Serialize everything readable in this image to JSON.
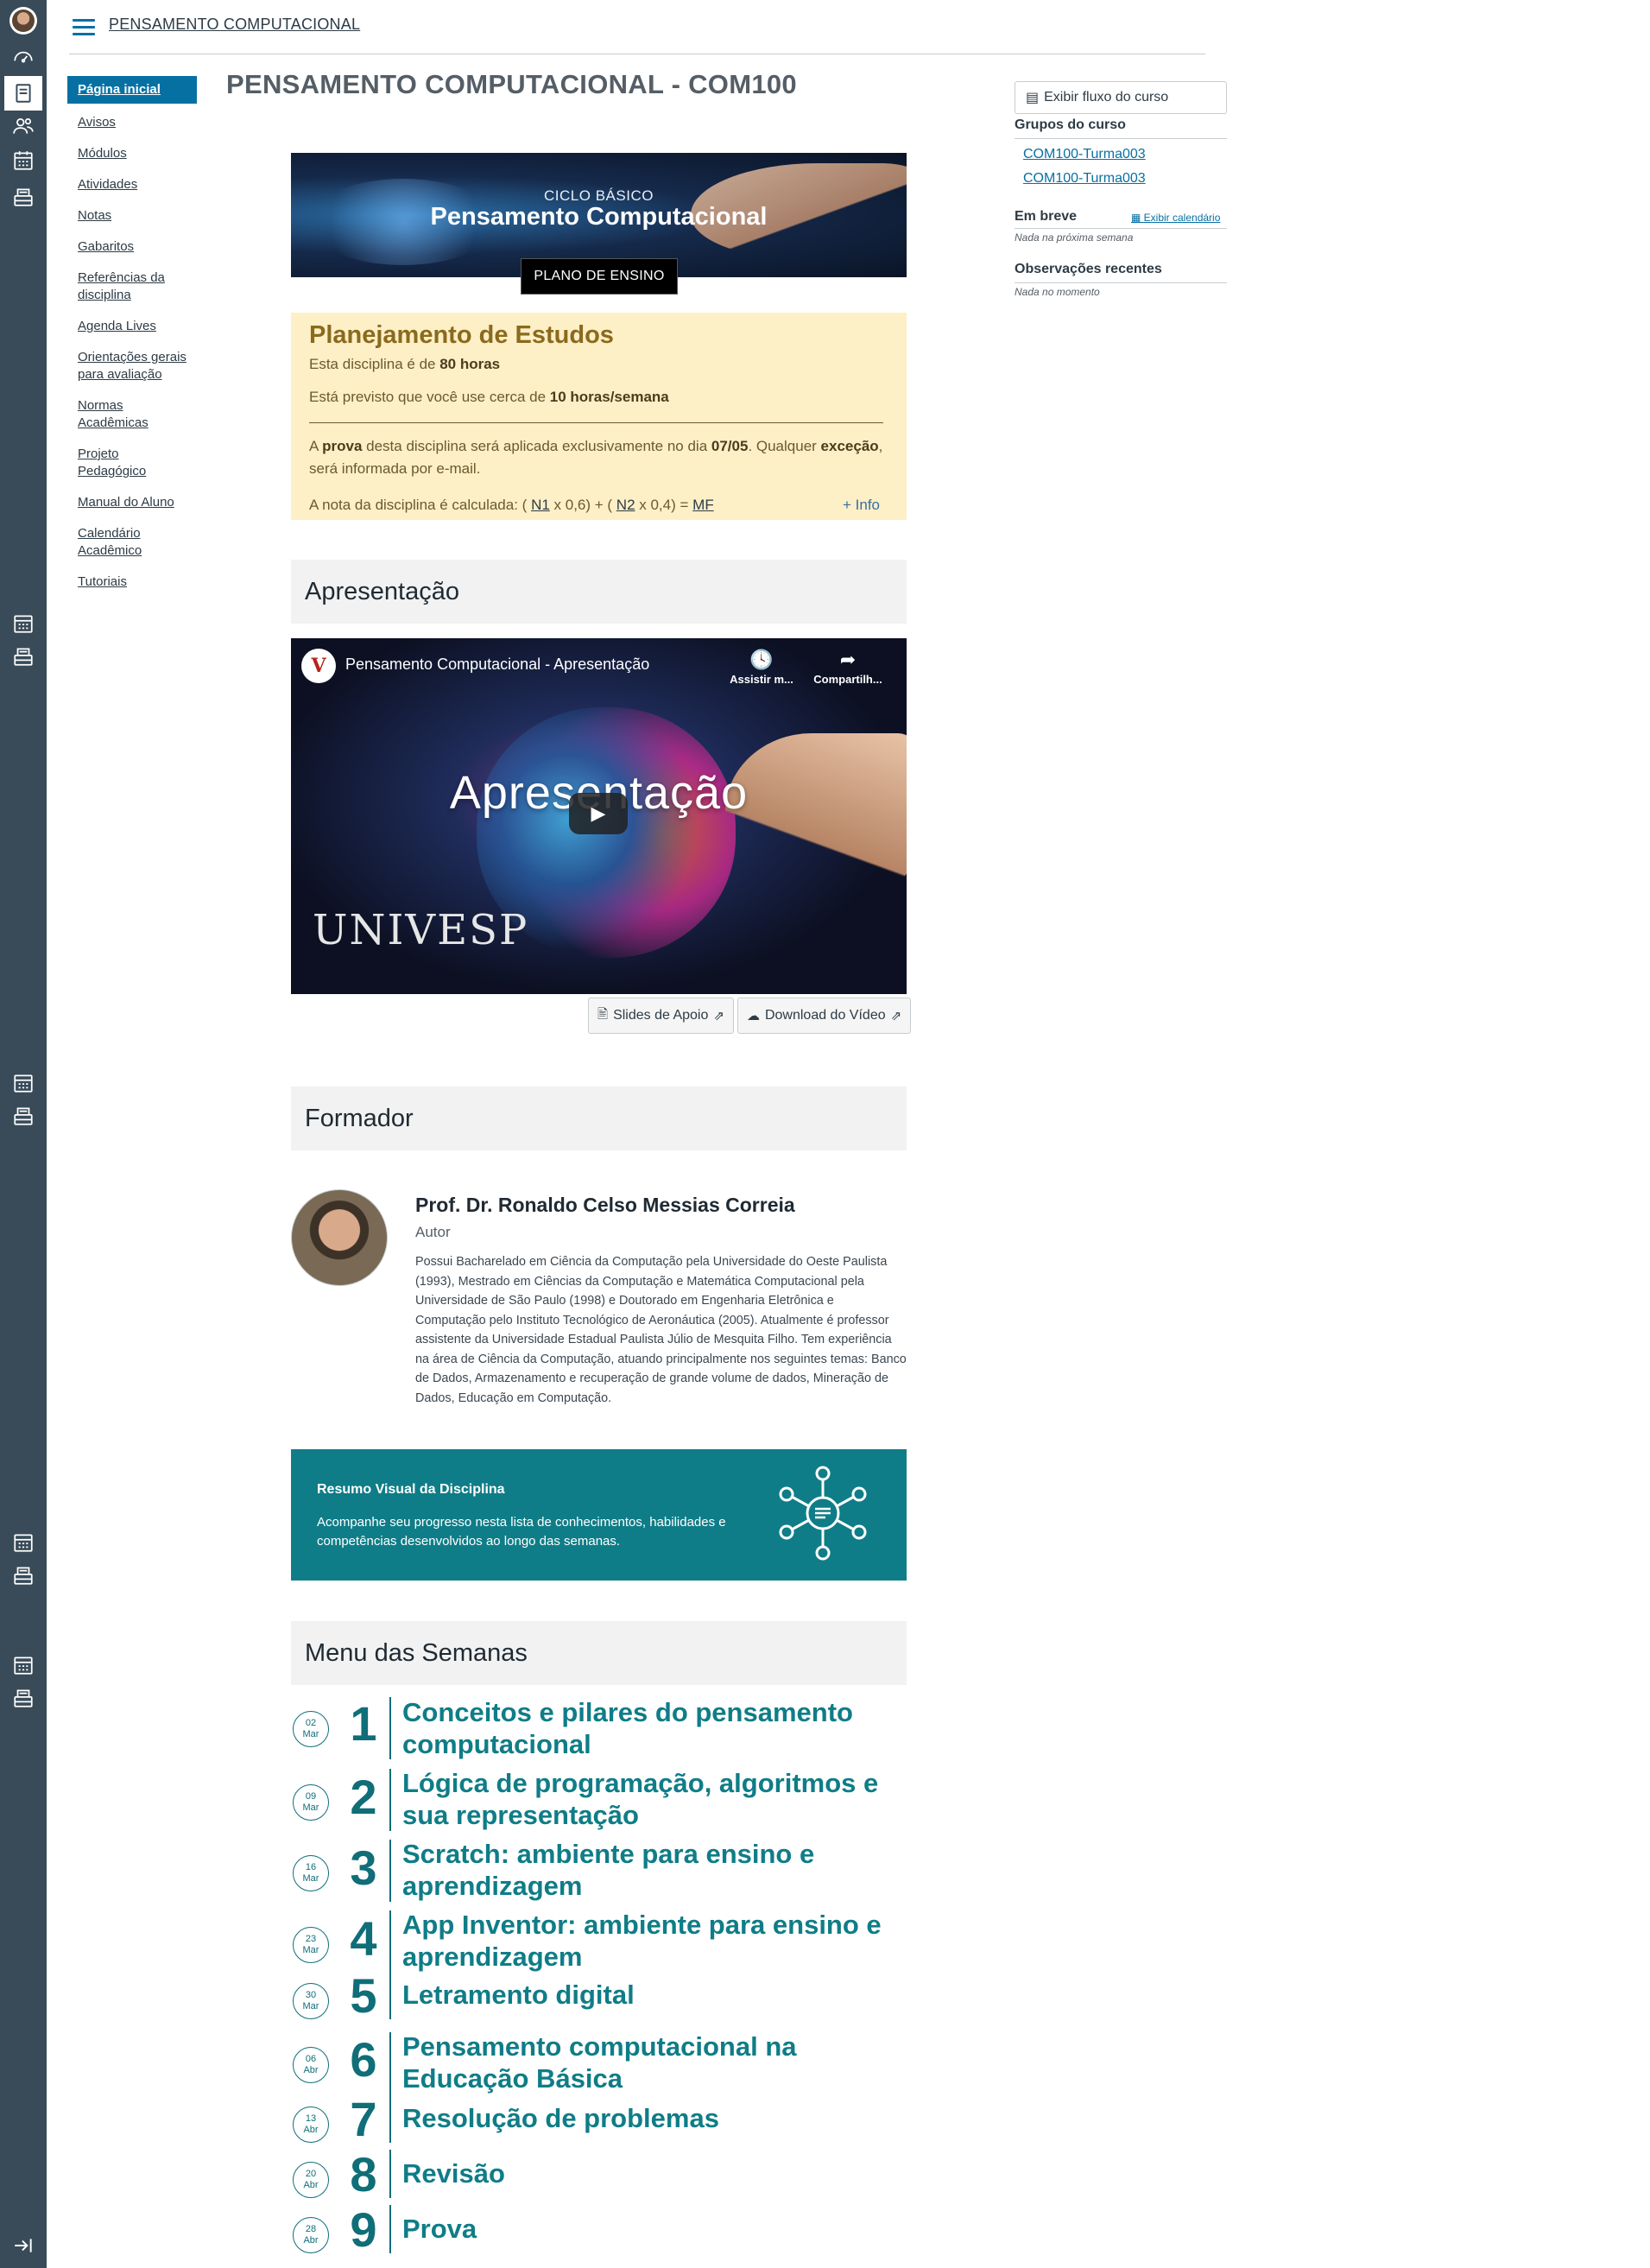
{
  "breadcrumb": "PENSAMENTO COMPUTACIONAL",
  "page_title": "PENSAMENTO COMPUTACIONAL - COM100",
  "course_nav": [
    {
      "label": "Página inicial",
      "active": true
    },
    {
      "label": "Avisos"
    },
    {
      "label": "Módulos"
    },
    {
      "label": "Atividades"
    },
    {
      "label": "Notas"
    },
    {
      "label": "Gabaritos"
    },
    {
      "label": "Referências da disciplina"
    },
    {
      "label": "Agenda Lives"
    },
    {
      "label": "Orientações gerais para avaliação"
    },
    {
      "label": "Normas Acadêmicas"
    },
    {
      "label": "Projeto Pedagógico"
    },
    {
      "label": "Manual do Aluno"
    },
    {
      "label": "Calendário Acadêmico"
    },
    {
      "label": "Tutoriais"
    }
  ],
  "banner": {
    "pre": "CICLO BÁSICO",
    "title": "Pensamento Computacional",
    "button": "PLANO DE ENSINO"
  },
  "plan": {
    "title": "Planejamento de Estudos",
    "hours_prefix": "Esta disciplina é de ",
    "hours": "80 horas",
    "weekly_prefix": "Está previsto que você use cerca de ",
    "weekly": "10 horas/semana",
    "exam_1": "A ",
    "exam_bold": "prova",
    "exam_2": " desta disciplina será aplicada exclusivamente no dia ",
    "exam_date": "07/05",
    "exam_3": ". Qualquer ",
    "exam_exc": "exceção",
    "exam_4": ", será informada por e-mail.",
    "formula_prefix": "A nota da disciplina é calculada: ( ",
    "n1": "N1",
    "mid": " x 0,6) + ( ",
    "n2": "N2",
    "end": " x 0,4) = ",
    "mf": "MF",
    "info": "+ Info"
  },
  "apresentacao": {
    "heading": "Apresentação",
    "video_title": "Pensamento Computacional - Apresentação",
    "watch_later": "Assistir m...",
    "share": "Compartilh...",
    "overlay": "Apresentação",
    "watermark": "UNIVESP",
    "slides_button": "Slides de Apoio",
    "download_button": "Download do Vídeo"
  },
  "formador": {
    "heading": "Formador",
    "name": "Prof. Dr. Ronaldo Celso Messias Correia",
    "role": "Autor",
    "bio": "Possui Bacharelado em Ciência da Computação pela Universidade do Oeste Paulista (1993), Mestrado em Ciências da Computação e Matemática Computacional pela Universidade de São Paulo (1998) e Doutorado em Engenharia Eletrônica e Computação pelo Instituto Tecnológico de Aeronáutica (2005). Atualmente é professor assistente da Universidade Estadual Paulista Júlio de Mesquita Filho. Tem experiência na área de Ciência da Computação, atuando principalmente nos seguintes temas: Banco de Dados, Armazenamento e recuperação de grande volume de dados, Mineração de Dados, Educação em Computação."
  },
  "resumo": {
    "title": "Resumo Visual da Disciplina",
    "text": "Acompanhe seu progresso nesta lista de conhecimentos, habilidades e competências desenvolvidos ao longo das semanas."
  },
  "weeks": {
    "heading": "Menu das Semanas",
    "items": [
      {
        "day": "02",
        "month": "Mar",
        "num": "1",
        "title": "Conceitos e pilares do pensamento computacional"
      },
      {
        "day": "09",
        "month": "Mar",
        "num": "2",
        "title": "Lógica de programação, algoritmos e sua representação"
      },
      {
        "day": "16",
        "month": "Mar",
        "num": "3",
        "title": "Scratch: ambiente para ensino e aprendizagem"
      },
      {
        "day": "23",
        "month": "Mar",
        "num": "4",
        "title": "App Inventor: ambiente para ensino e aprendizagem"
      },
      {
        "day": "30",
        "month": "Mar",
        "num": "5",
        "title": "Letramento digital"
      },
      {
        "day": "06",
        "month": "Abr",
        "num": "6",
        "title": "Pensamento computacional na Educação Básica"
      },
      {
        "day": "13",
        "month": "Abr",
        "num": "7",
        "title": "Resolução de problemas"
      },
      {
        "day": "20",
        "month": "Abr",
        "num": "8",
        "title": "Revisão"
      },
      {
        "day": "28",
        "month": "Abr",
        "num": "9",
        "title": "Prova"
      }
    ]
  },
  "sidebar": {
    "flux_button": "Exibir fluxo do curso",
    "groups_heading": "Grupos do curso",
    "groups": [
      "COM100-Turma003",
      "COM100-Turma003"
    ],
    "soon_heading": "Em breve",
    "calendar_link": "Exibir calendário",
    "soon_note": "Nada na próxima semana",
    "recent_heading": "Observações recentes",
    "recent_note": "Nada no momento"
  },
  "colors": {
    "nav_bg": "#394b58",
    "accent": "#0770a3",
    "teal": "#0f7d87",
    "plan_bg": "#fdefc6"
  }
}
